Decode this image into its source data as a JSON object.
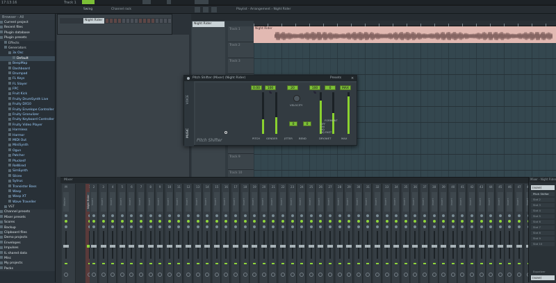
{
  "topbar": {
    "time": "17:13:16",
    "track": "Track 1"
  },
  "toolbar": {
    "channel_rack_title": "Channel rack",
    "playlist_title": "Playlist - Arrangement › Night Rider",
    "swing_label": "Swing"
  },
  "browser": {
    "header": "Browser - All",
    "items": [
      {
        "label": "Current project",
        "lvl": "cat"
      },
      {
        "label": "Recent files",
        "lvl": "cat"
      },
      {
        "label": "Plugin database",
        "lvl": "cat"
      },
      {
        "label": "Plugin presets",
        "lvl": "cat"
      },
      {
        "label": "Effects",
        "lvl": "g1"
      },
      {
        "label": "Generators",
        "lvl": "g1"
      },
      {
        "label": "3x Osc",
        "lvl": "g2"
      },
      {
        "label": "Default",
        "lvl": "g3",
        "sel": true
      },
      {
        "label": "BeepMap",
        "lvl": "g2"
      },
      {
        "label": "Dashboard",
        "lvl": "g2"
      },
      {
        "label": "Drumpad",
        "lvl": "g2"
      },
      {
        "label": "FL Keys",
        "lvl": "g2"
      },
      {
        "label": "FL Slayer",
        "lvl": "g2"
      },
      {
        "label": "FPC",
        "lvl": "g2"
      },
      {
        "label": "Fruit Kick",
        "lvl": "g2"
      },
      {
        "label": "Fruity DrumSynth Live",
        "lvl": "g2"
      },
      {
        "label": "Fruity DX10",
        "lvl": "g2"
      },
      {
        "label": "Fruity Envelope Controller",
        "lvl": "g2"
      },
      {
        "label": "Fruity Granulizer",
        "lvl": "g2"
      },
      {
        "label": "Fruity Keyboard Controller",
        "lvl": "g2"
      },
      {
        "label": "Fruity Video Player",
        "lvl": "g2"
      },
      {
        "label": "Harmless",
        "lvl": "g2"
      },
      {
        "label": "Harmor",
        "lvl": "g2"
      },
      {
        "label": "MIDI Out",
        "lvl": "g2"
      },
      {
        "label": "MiniSynth",
        "lvl": "g2"
      },
      {
        "label": "Ogun",
        "lvl": "g2"
      },
      {
        "label": "Patcher",
        "lvl": "g2"
      },
      {
        "label": "Plucked!",
        "lvl": "g2"
      },
      {
        "label": "ReWired",
        "lvl": "g2"
      },
      {
        "label": "SimSynth",
        "lvl": "g2"
      },
      {
        "label": "Slicex",
        "lvl": "g2"
      },
      {
        "label": "Sytrus",
        "lvl": "g2"
      },
      {
        "label": "Transistor Bass",
        "lvl": "g2"
      },
      {
        "label": "Wasp",
        "lvl": "g2"
      },
      {
        "label": "Wasp XT",
        "lvl": "g2"
      },
      {
        "label": "Wave Traveller",
        "lvl": "g2"
      },
      {
        "label": "VST",
        "lvl": "g1"
      },
      {
        "label": "Channel presets",
        "lvl": "cat"
      },
      {
        "label": "Mixer presets",
        "lvl": "cat"
      },
      {
        "label": "Scores",
        "lvl": "cat"
      },
      {
        "label": "Backup",
        "lvl": "cat"
      },
      {
        "label": "Clipboard files",
        "lvl": "cat"
      },
      {
        "label": "Demo projects",
        "lvl": "cat"
      },
      {
        "label": "Envelopes",
        "lvl": "cat"
      },
      {
        "label": "Impulses",
        "lvl": "cat"
      },
      {
        "label": "IL shared data",
        "lvl": "cat"
      },
      {
        "label": "Misc",
        "lvl": "cat"
      },
      {
        "label": "My projects",
        "lvl": "cat"
      },
      {
        "label": "Packs",
        "lvl": "cat"
      }
    ]
  },
  "channel_rack": {
    "channel_name": "Night Rider"
  },
  "playlist": {
    "pattern": "Night Rider",
    "clip_label": "Night Rider",
    "tracks": [
      "Track 1",
      "Track 2",
      "Track 3",
      "Track 4",
      "Track 5",
      "Track 6",
      "Track 7",
      "Track 8",
      "Track 9",
      "Track 10"
    ]
  },
  "plugin": {
    "title": "Pitch Shifter (Mixer) (Night Rider)",
    "presets_label": "Presets",
    "tab_voice": "VOICE",
    "tab_music": "MUSIC",
    "brand": "Pitch Shifter",
    "values": [
      "0.00",
      "100 %",
      "20",
      "100 %",
      "0",
      "MAX"
    ],
    "pitch_label": "PITCH",
    "gender_label": "GENDER",
    "gender_value": "0.00",
    "velocity_label": "VELOCITY",
    "jitter_label": "JITTER",
    "bend_label": "BEND",
    "detune_value": "0",
    "bend_value": "0",
    "dry_wet_label": "DRY/WET",
    "max_label": "MAX",
    "formant_label": "FORMANT",
    "opt_options": [
      "OFF",
      "ON",
      "HQ",
      "HQ FAST"
    ]
  },
  "mixer": {
    "title": "Mixer",
    "master_label": "Master",
    "insert1_label": "Night Rider",
    "insert_prefix": "Insert",
    "insert_numbers": [
      "M",
      "1",
      "2",
      "3",
      "4",
      "5",
      "6",
      "7",
      "8",
      "9",
      "10",
      "11",
      "12",
      "13",
      "14",
      "15",
      "16",
      "17",
      "18",
      "19",
      "20",
      "21",
      "22",
      "23",
      "24",
      "25",
      "26",
      "27",
      "28",
      "29",
      "30",
      "31",
      "32",
      "33",
      "34",
      "35",
      "36",
      "37",
      "38",
      "39",
      "40",
      "41",
      "42",
      "43",
      "44",
      "45",
      "46",
      "47",
      "48"
    ]
  },
  "fx": {
    "title": "Mixer - Night Rider",
    "input": "(none)",
    "slot1": "Pitch Shifter",
    "slots": [
      "Slot 2",
      "Slot 3",
      "Slot 4",
      "Slot 5",
      "Slot 6",
      "Slot 7",
      "Slot 8",
      "Slot 9",
      "Slot 10"
    ],
    "output_label": "Equalizer",
    "output": "(none)"
  }
}
